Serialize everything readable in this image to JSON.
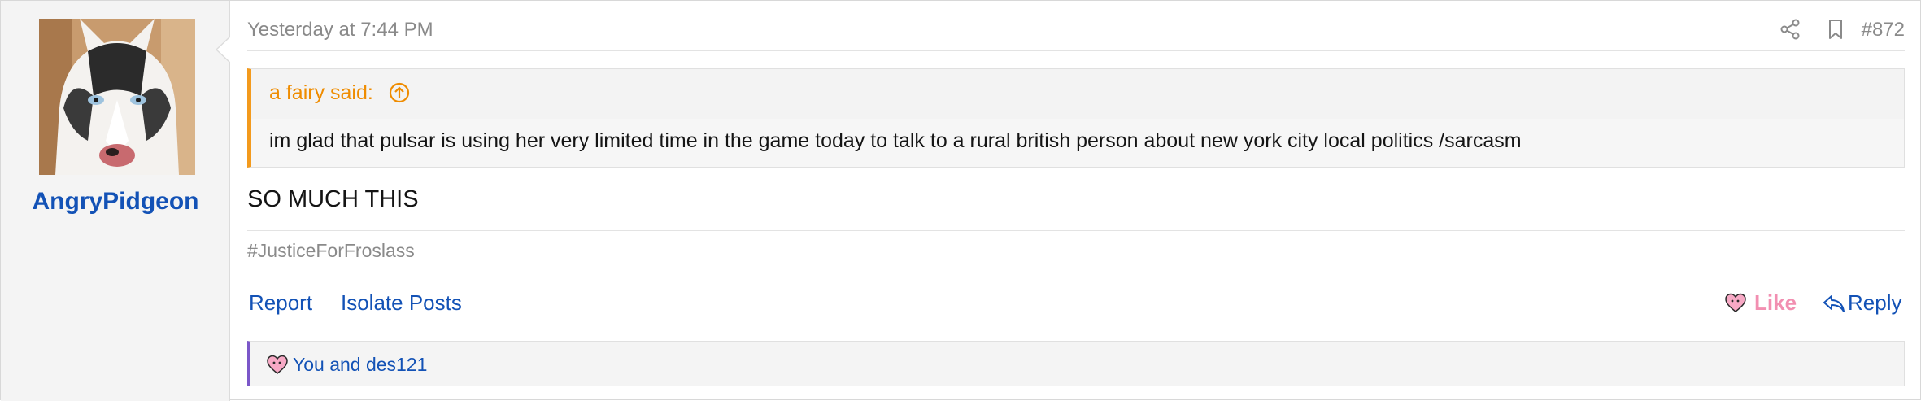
{
  "user": {
    "username": "AngryPidgeon",
    "avatar_icon": "husky-avatar-image"
  },
  "post": {
    "timestamp": "Yesterday at 7:44 PM",
    "number": "#872",
    "share_icon": "share-icon",
    "bookmark_icon": "bookmark-icon",
    "quote": {
      "author_label": "a fairy said:",
      "up_icon": "arrow-up-circle-icon",
      "text": "im glad that pulsar is using her very limited time in the game today to talk to a rural british person about new york city local politics /sarcasm"
    },
    "message": "SO MUCH THIS",
    "signature": "#JusticeForFroslass"
  },
  "actions": {
    "report": "Report",
    "isolate": "Isolate Posts",
    "like": "Like",
    "reply": "Reply"
  },
  "reactions": {
    "text": "You and des121",
    "icon": "heart-reaction-icon"
  },
  "colors": {
    "link": "#1352b6",
    "quote_accent": "#f39a1d",
    "like_pink": "#f28fb1",
    "reaction_bar": "#7b57c9",
    "muted_text": "#8a8a8a"
  }
}
